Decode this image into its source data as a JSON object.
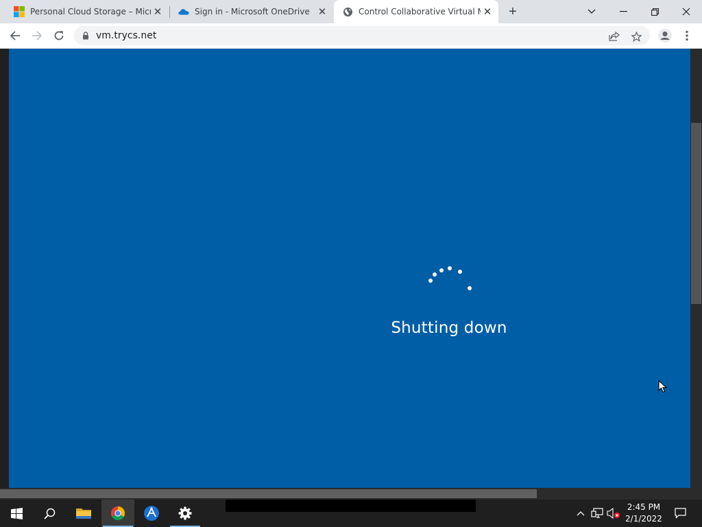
{
  "browser": {
    "tabs": [
      {
        "title": "Personal Cloud Storage – Microsoft",
        "favicon": "microsoft-logo-icon",
        "active": false
      },
      {
        "title": "Sign in - Microsoft OneDrive",
        "favicon": "onedrive-cloud-icon",
        "active": false
      },
      {
        "title": "Control Collaborative Virtual Ma",
        "favicon": "globe-icon",
        "active": true
      }
    ],
    "close_glyph": "✕",
    "new_tab_glyph": "+",
    "address": {
      "url": "vm.trycs.net"
    }
  },
  "vm": {
    "status_text": "Shutting down",
    "background_color": "#005ea6"
  },
  "taskbar": {
    "pinned": [
      {
        "name": "start-button",
        "icon": "windows-logo-icon"
      },
      {
        "name": "search-button",
        "icon": "search-icon"
      },
      {
        "name": "file-explorer-button",
        "icon": "folder-icon"
      },
      {
        "name": "chrome-button",
        "icon": "chrome-icon"
      },
      {
        "name": "app-button",
        "icon": "app-icon"
      },
      {
        "name": "settings-button",
        "icon": "gear-icon"
      }
    ],
    "clock": {
      "time": "2:45 PM",
      "date": "2/1/2022"
    }
  },
  "colors": {
    "accent": "#76b9ed",
    "vm_blue": "#005ea6",
    "tab_strip": "#dee1e6"
  }
}
